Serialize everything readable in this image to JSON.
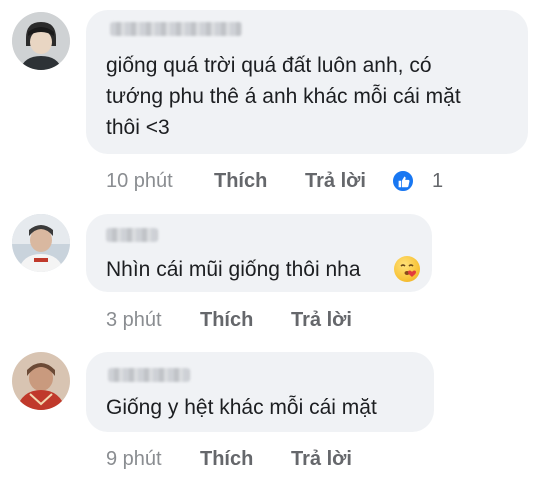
{
  "comments": [
    {
      "text": "giống quá trời quá đất luôn anh, có\ntướng phu thê á anh khác mỗi cái mặt\nthôi <3",
      "time": "10 phút",
      "like_label": "Thích",
      "reply_label": "Trả lời",
      "reaction_icon": "like-icon",
      "reaction_count": "1"
    },
    {
      "text": "Nhìn cái mũi giống thôi nha",
      "emoji": "kissing-face-emoji",
      "time": "3 phút",
      "like_label": "Thích",
      "reply_label": "Trả lời"
    },
    {
      "text": "Giống y hệt khác mỗi cái mặt",
      "time": "9 phút",
      "like_label": "Thích",
      "reply_label": "Trả lời"
    }
  ],
  "colors": {
    "bubble": "#f0f2f5",
    "text": "#1c1e21",
    "meta": "#65676b",
    "like_badge": "#1877f2"
  }
}
